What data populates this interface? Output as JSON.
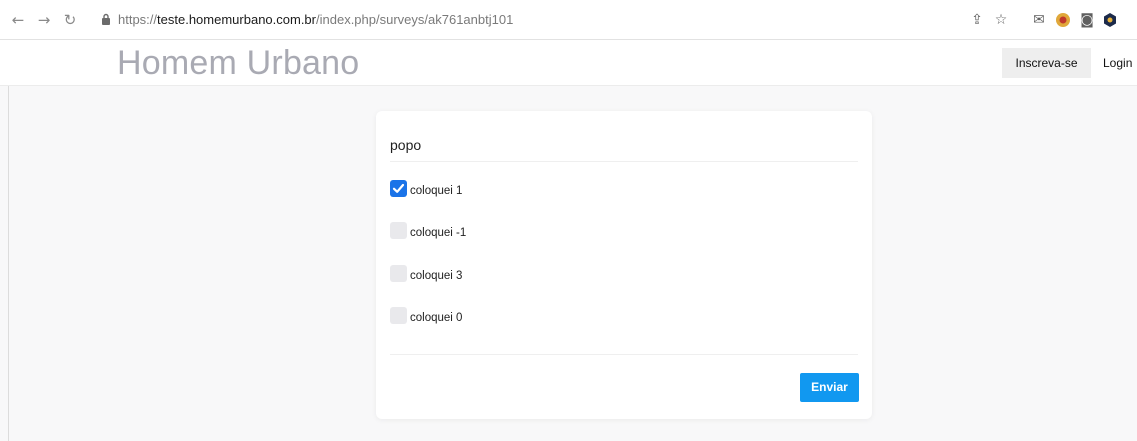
{
  "browser": {
    "url_scheme": "https://",
    "url_host": "teste.homemurbano.com.br",
    "url_path": "/index.php/surveys/ak761anbtj101"
  },
  "header": {
    "brand": "Homem Urbano",
    "signup_label": "Inscreva-se",
    "login_label": "Login"
  },
  "survey": {
    "question": "popo",
    "options": [
      {
        "label": "coloquei 1",
        "checked": true
      },
      {
        "label": "coloquei -1",
        "checked": false
      },
      {
        "label": "coloquei 3",
        "checked": false
      },
      {
        "label": "coloquei 0",
        "checked": false
      }
    ],
    "submit_label": "Enviar"
  },
  "colors": {
    "brand_text": "#a9aab3",
    "checkbox_checked": "#1a73e8",
    "submit_button": "#1198f0"
  }
}
